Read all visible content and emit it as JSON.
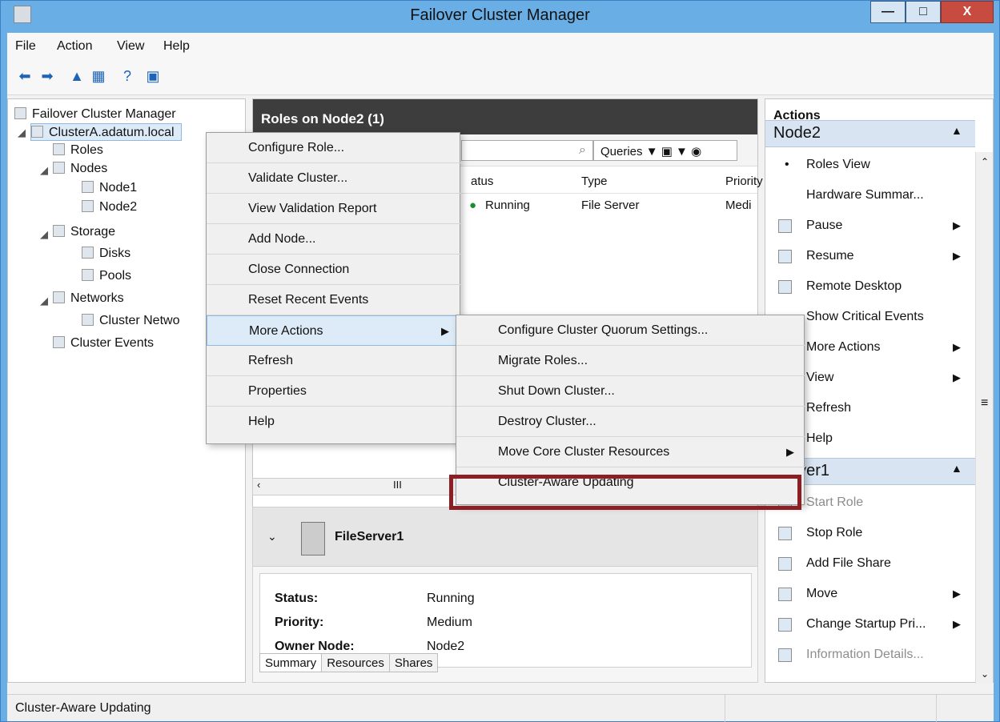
{
  "window": {
    "title": "Failover Cluster Manager",
    "controls": [
      "minimize",
      "maximize",
      "close"
    ]
  },
  "menu": [
    "File",
    "Action",
    "View",
    "Help"
  ],
  "toolbar": [
    "back-icon",
    "forward-icon",
    "up-icon",
    "show-hide-icon",
    "help-icon",
    "console-icon"
  ],
  "tree": [
    {
      "label": "Failover Cluster Manager"
    },
    {
      "label": "ClusterA.adatum.local"
    },
    {
      "label": "Roles"
    },
    {
      "label": "Nodes"
    },
    {
      "label": "Node1"
    },
    {
      "label": "Node2"
    },
    {
      "label": "Storage"
    },
    {
      "label": "Disks"
    },
    {
      "label": "Pools"
    },
    {
      "label": "Networks"
    },
    {
      "label": "Cluster Netwo"
    },
    {
      "label": "Cluster Events"
    }
  ],
  "center": {
    "title": "Roles on Node2 (1)",
    "queries": "Queries",
    "columns": [
      "atus",
      "Type",
      "Priority"
    ],
    "row": {
      "status": "Running",
      "type": "File Server",
      "priority": "Medi"
    },
    "scroll_label": "III"
  },
  "details": {
    "name": "FileServer1",
    "fields": [
      {
        "label": "Status:",
        "value": "Running"
      },
      {
        "label": "Priority:",
        "value": "Medium"
      },
      {
        "label": "Owner Node:",
        "value": "Node2"
      }
    ],
    "tabs": [
      "Summary",
      "Resources",
      "Shares"
    ]
  },
  "context_menu": [
    {
      "label": "Configure Role..."
    },
    {
      "label": "Validate Cluster..."
    },
    {
      "label": "View Validation Report"
    },
    {
      "label": "Add Node..."
    },
    {
      "label": "Close Connection"
    },
    {
      "label": "Reset Recent Events"
    },
    {
      "label": "More Actions",
      "submenu": true
    },
    {
      "label": "Refresh"
    },
    {
      "label": "Properties"
    },
    {
      "label": "Help"
    }
  ],
  "submenu": [
    {
      "label": "Configure Cluster Quorum Settings..."
    },
    {
      "label": "Migrate Roles..."
    },
    {
      "label": "Shut Down Cluster..."
    },
    {
      "label": "Destroy Cluster..."
    },
    {
      "label": "Move Core Cluster Resources",
      "submenu": true
    },
    {
      "label": "Cluster-Aware Updating",
      "highlighted": true
    }
  ],
  "actions": {
    "title": "Actions",
    "section1": "Node2",
    "section1_items": [
      {
        "label": "Roles View"
      },
      {
        "label": "Hardware Summar..."
      },
      {
        "label": "Pause",
        "submenu": true
      },
      {
        "label": "Resume",
        "submenu": true
      },
      {
        "label": "Remote Desktop"
      },
      {
        "label": "Show Critical Events"
      },
      {
        "label": "More Actions",
        "submenu": true
      },
      {
        "label": "View",
        "submenu": true
      },
      {
        "label": "Refresh"
      },
      {
        "label": "Help"
      }
    ],
    "section2": "Server1",
    "section2_items": [
      {
        "label": "Start Role",
        "disabled": true
      },
      {
        "label": "Stop Role"
      },
      {
        "label": "Add File Share"
      },
      {
        "label": "Move",
        "submenu": true
      },
      {
        "label": "Change Startup Pri...",
        "submenu": true
      },
      {
        "label": "Information Details...",
        "disabled": true
      }
    ]
  },
  "status": "Cluster-Aware Updating",
  "colors": {
    "title_blue": "#6aaee6",
    "highlight_red": "#8b1f23",
    "selection": "#ddebf8"
  }
}
